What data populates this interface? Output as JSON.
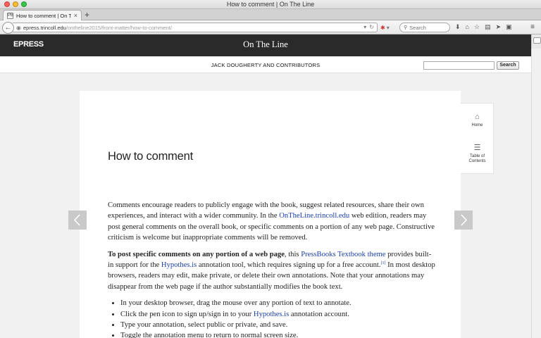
{
  "window": {
    "title": "How to comment | On The Line"
  },
  "tab": {
    "title": "How to comment | On The...",
    "favicon": "PB",
    "close": "×",
    "new_tab": "+"
  },
  "nav": {
    "back": "←",
    "url_host": "epress.trincoll.edu",
    "url_path": "/ontheline2015/front-matter/how-to-comment/",
    "search_placeholder": "Search"
  },
  "site": {
    "logo": "EPRESS",
    "book_title": "On The Line",
    "authors": "JACK DOUGHERTY AND CONTRIBUTORS",
    "search_button": "Search"
  },
  "sidenav": {
    "home_label": "Home",
    "toc_label_1": "Table of",
    "toc_label_2": "Contents"
  },
  "chapter": {
    "title": "How to comment",
    "p1_a": "Comments encourage readers to publicly engage with the book, suggest related resources, share their own experiences, and interact with a wider community. In the ",
    "p1_link": "OnTheLine.trincoll.edu",
    "p1_b": " web edition, readers may post general comments on the overall book, or specific comments on a portion of any web page. Constructive criticism is welcome but inappropriate comments will be removed.",
    "p2_bold": "To post specific comments on any portion of a web page",
    "p2_a": ", this ",
    "p2_link1": "PressBooks Textbook theme",
    "p2_b": " provides built-in support for the ",
    "p2_link2": "Hypothes.is",
    "p2_c": " annotation tool, which requires signing up for a free account.",
    "p2_sup": "[1]",
    "p2_d": " In most desktop browsers, readers may edit, make private, or delete their own annotations. Note that your annotations may disappear from the web page if the author substantially modifies the book text.",
    "li1": "In your desktop browser, drag the mouse over any portion of text to annotate.",
    "li2_a": "Click the pen icon to sign up/sign in to your ",
    "li2_link": "Hypothes.is",
    "li2_b": " annotation account.",
    "li3": "Type your annotation, select public or private, and save.",
    "li4": "Toggle the annotation menu to return to normal screen size."
  }
}
